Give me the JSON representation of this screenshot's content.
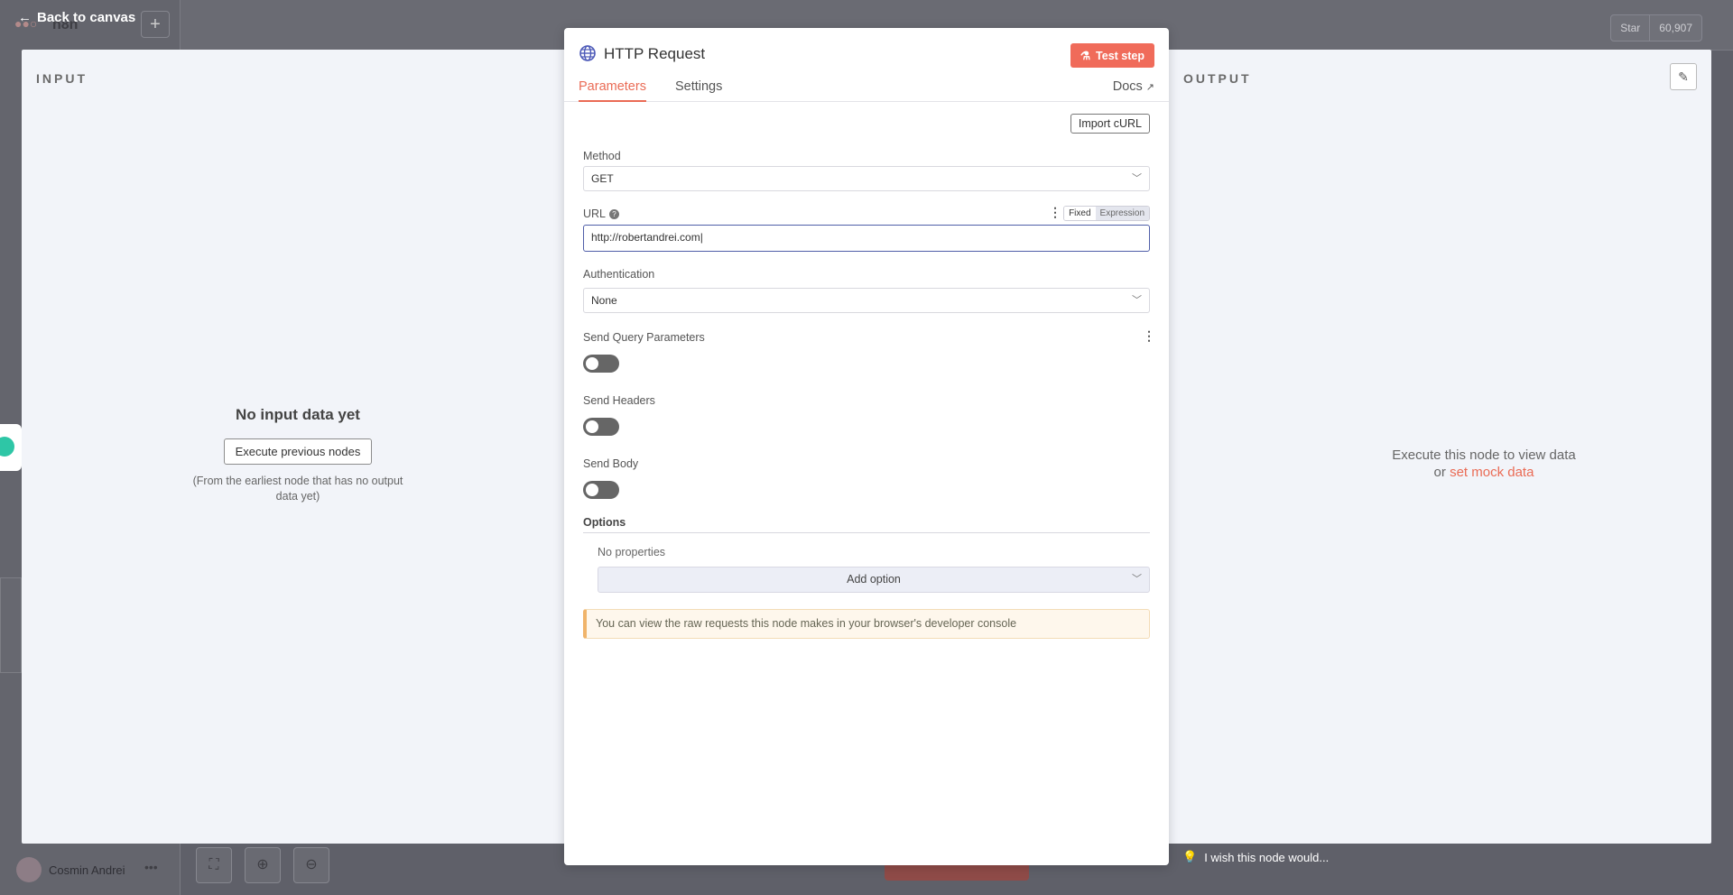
{
  "background": {
    "app_name": "n8n",
    "github": {
      "label": "Star",
      "count": "60,907"
    },
    "user_name": "Cosmin Andrei"
  },
  "back_link": "Back to canvas",
  "input_panel": {
    "title": "INPUT",
    "empty_title": "No input data yet",
    "execute_button": "Execute previous nodes",
    "hint": "(From the earliest node that has no output data yet)"
  },
  "output_panel": {
    "title": "OUTPUT",
    "message_line1": "Execute this node to view data",
    "message_or": "or",
    "mock_link": "set mock data"
  },
  "node": {
    "title": "HTTP Request",
    "test_button": "Test step",
    "tabs": [
      "Parameters",
      "Settings"
    ],
    "docs": "Docs",
    "import_curl": "Import cURL",
    "method": {
      "label": "Method",
      "value": "GET"
    },
    "url": {
      "label": "URL",
      "value": "http://robertandrei.com",
      "mode_fixed": "Fixed",
      "mode_expression": "Expression"
    },
    "authentication": {
      "label": "Authentication",
      "value": "None"
    },
    "send_query": {
      "label": "Send Query Parameters"
    },
    "send_headers": {
      "label": "Send Headers"
    },
    "send_body": {
      "label": "Send Body"
    },
    "options": {
      "label": "Options",
      "empty": "No properties",
      "add": "Add option"
    },
    "notice": "You can view the raw requests this node makes in your browser's developer console"
  },
  "feedback": "I wish this node would...",
  "colors": {
    "accent": "#ea6b55",
    "focus": "#4f5ea8",
    "toggle_off": "#666666"
  }
}
